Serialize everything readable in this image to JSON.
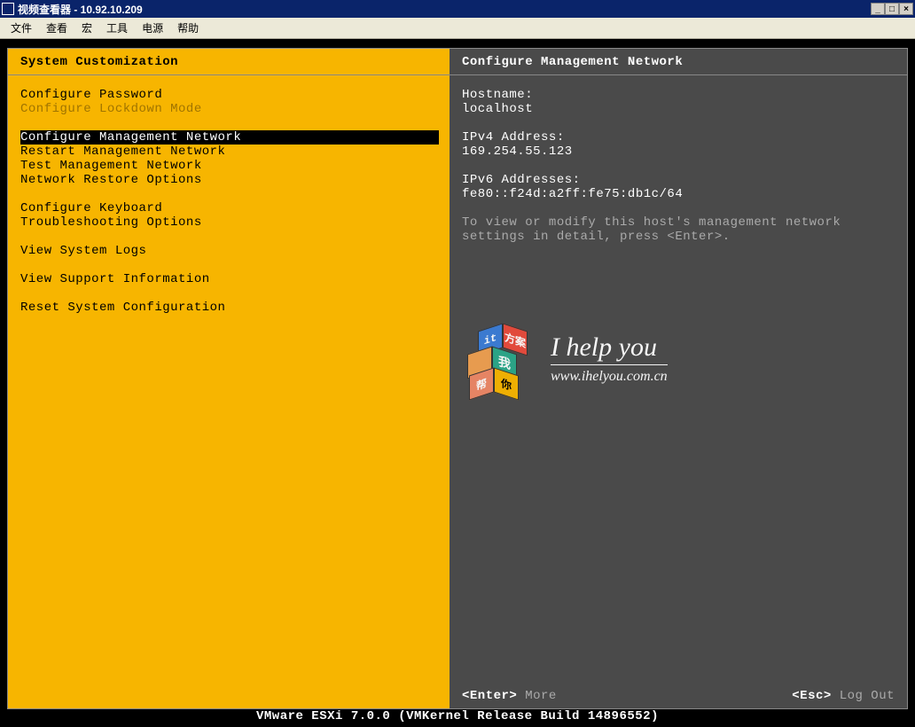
{
  "window": {
    "title": "视频查看器 - 10.92.10.209"
  },
  "menubar": [
    "文件",
    "查看",
    "宏",
    "工具",
    "电源",
    "帮助"
  ],
  "left": {
    "header": "System Customization",
    "groups": [
      [
        {
          "label": "Configure Password",
          "dim": false
        },
        {
          "label": "Configure Lockdown Mode",
          "dim": true
        }
      ],
      [
        {
          "label": "Configure Management Network",
          "selected": true
        },
        {
          "label": "Restart Management Network"
        },
        {
          "label": "Test Management Network"
        },
        {
          "label": "Network Restore Options"
        }
      ],
      [
        {
          "label": "Configure Keyboard"
        },
        {
          "label": "Troubleshooting Options"
        }
      ],
      [
        {
          "label": "View System Logs"
        }
      ],
      [
        {
          "label": "View Support Information"
        }
      ],
      [
        {
          "label": "Reset System Configuration"
        }
      ]
    ]
  },
  "right": {
    "header": "Configure Management Network",
    "hostname_label": "Hostname:",
    "hostname": "localhost",
    "ipv4_label": "IPv4 Address:",
    "ipv4": "169.254.55.123",
    "ipv6_label": "IPv6 Addresses:",
    "ipv6": "fe80::f24d:a2ff:fe75:db1c/64",
    "hint": "To view or modify this host's management network settings in detail, press <Enter>."
  },
  "watermark": {
    "title": "I help you",
    "url": "www.ihelyou.com.cn",
    "cube": {
      "t1": "it",
      "t2": "方案",
      "t3": "",
      "t4": "我",
      "t5": "帮",
      "t6": "你"
    }
  },
  "footer": {
    "enter_key": "<Enter>",
    "enter_label": "More",
    "esc_key": "<Esc>",
    "esc_label": "Log Out"
  },
  "bottom": "VMware ESXi 7.0.0 (VMKernel Release Build 14896552)"
}
